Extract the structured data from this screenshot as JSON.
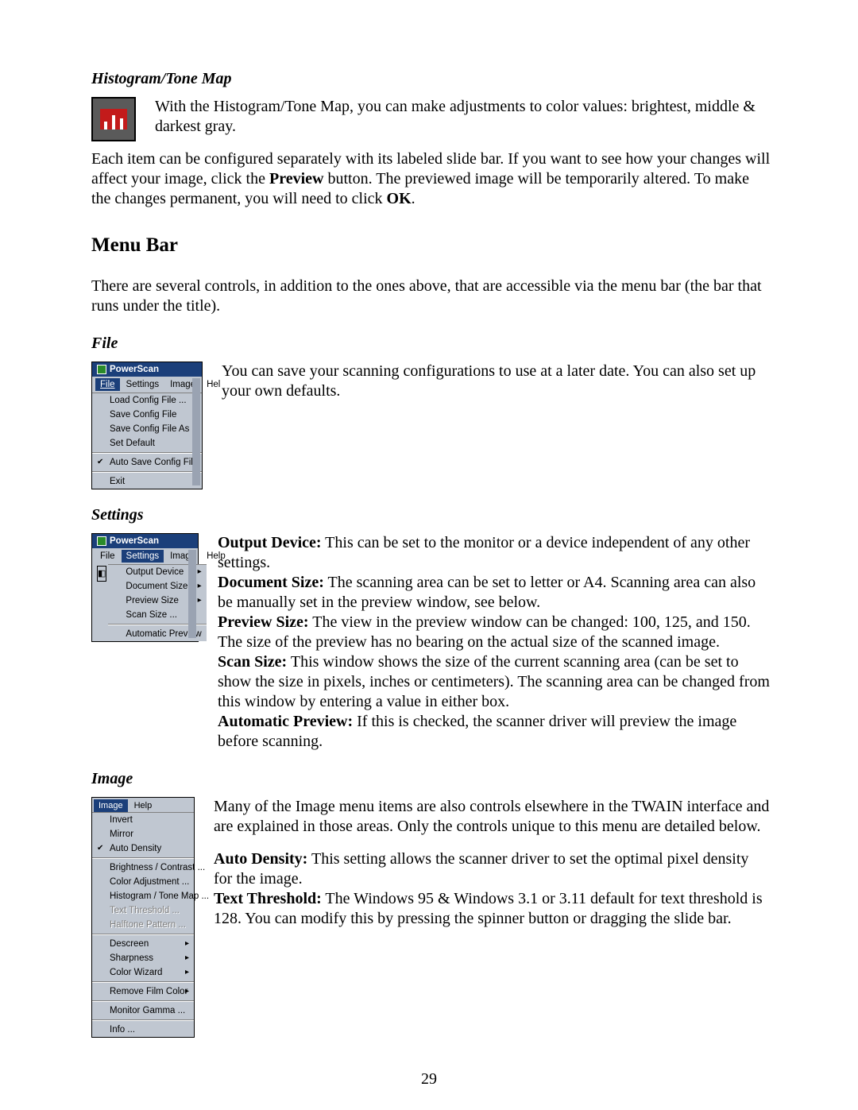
{
  "histogram": {
    "heading": "Histogram/Tone Map",
    "intro": "With the Histogram/Tone Map, you can make adjustments to color values: brightest, middle & darkest gray."
  },
  "para_config_a": "Each item can be configured separately with its labeled slide bar.  If you want to see how your changes will affect your image, click the ",
  "preview_word": "Preview",
  "para_config_b": " button.  The previewed image will be temporarily altered.  To make the changes permanent, you will need to click  ",
  "ok_word": "OK",
  "period": ".",
  "menubar_heading": "Menu Bar",
  "menubar_intro": "There are several controls, in addition to the ones above, that are accessible via the menu bar (the bar that runs under the title).",
  "file": {
    "heading": "File",
    "desc": "You can save your scanning configurations to use at a later date.  You can also set up your own defaults.",
    "win_title": "PowerScan",
    "menu": {
      "file": "File",
      "settings": "Settings",
      "image": "Image",
      "help": "Hel"
    },
    "items": {
      "load": "Load Config File ...",
      "save": "Save Config File",
      "saveas": "Save Config File As ...",
      "setdef": "Set Default",
      "autosave": "Auto Save Config File",
      "exit": "Exit"
    }
  },
  "settings": {
    "heading": "Settings",
    "win_title": "PowerScan",
    "menu": {
      "file": "File",
      "settings": "Settings",
      "image": "Image",
      "help": "Help"
    },
    "items": {
      "outdev": "Output Device",
      "docsize": "Document Size",
      "prevsize": "Preview Size",
      "scansize": "Scan Size ...",
      "autoprev": "Automatic Preview"
    },
    "outdev_l": "Output Device:",
    "outdev_t": " This can be set to the monitor or a device independent of any other settings.",
    "docsize_l": "Document Size:",
    "docsize_t": " The scanning area can be set to letter or A4.  Scanning area can also be manually set in the preview window, see below.",
    "prevsize_l": "Preview Size:",
    "prevsize_t": " The view in the preview window can be changed: 100, 125, and 150.  The size of the preview has no bearing on the actual size of the scanned image.",
    "scansize_l": "Scan Size:",
    "scansize_t": " This window shows the size of the current scanning area (can be set to show the size in pixels, inches or centimeters).  The scanning area can be changed from this window by entering a value in either box.",
    "autoprev_l": "Automatic Preview:",
    "autoprev_t": " If this is checked, the scanner driver will preview the image before scanning."
  },
  "image": {
    "heading": "Image",
    "menu": {
      "image": "Image",
      "help": "Help"
    },
    "items": {
      "invert": "Invert",
      "mirror": "Mirror",
      "autodensity": "Auto Density",
      "bc": "Brightness / Contrast ...",
      "coloradj": "Color Adjustment ...",
      "hist": "Histogram / Tone Map ...",
      "textthresh": "Text Threshold ...",
      "halftone": "Halftone Pattern ...",
      "descreen": "Descreen",
      "sharpness": "Sharpness",
      "colorwiz": "Color Wizard",
      "removefilm": "Remove Film Color",
      "mongamma": "Monitor Gamma ...",
      "info": "Info ..."
    },
    "intro": "Many of the Image menu items are also controls elsewhere in the TWAIN interface and are explained in those areas.  Only the controls unique to this menu are detailed below.",
    "autod_l": "Auto Density:",
    "autod_t": " This setting allows the scanner driver to set the optimal pixel density for the image.",
    "textt_l": "Text Threshold:",
    "textt_t": " The Windows 95 & Windows 3.1 or 3.11 default for text threshold is 128.  You can modify this by pressing the spinner button or dragging the slide bar."
  },
  "page_number": "29"
}
